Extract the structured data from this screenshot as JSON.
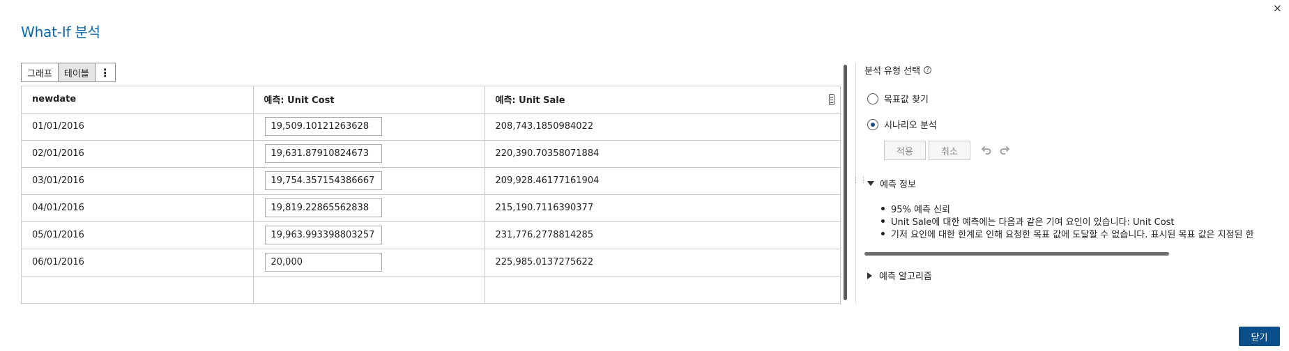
{
  "dialog": {
    "title": "What-If 분석",
    "close_icon": "×"
  },
  "toolbar": {
    "graph_label": "그래프",
    "table_label": "테이블",
    "more_icon": "⋮"
  },
  "table": {
    "columns": [
      "newdate",
      "예측: Unit Cost",
      "예측: Unit Sale"
    ],
    "rows": [
      {
        "date": "01/01/2016",
        "unit_cost": "19,509.10121263628",
        "unit_sale": "208,743.1850984022"
      },
      {
        "date": "02/01/2016",
        "unit_cost": "19,631.87910824673",
        "unit_sale": "220,390.70358071884"
      },
      {
        "date": "03/01/2016",
        "unit_cost": "19,754.357154386667",
        "unit_sale": "209,928.46177161904"
      },
      {
        "date": "04/01/2016",
        "unit_cost": "19,819.22865562838",
        "unit_sale": "215,190.7116390377"
      },
      {
        "date": "05/01/2016",
        "unit_cost": "19,963.993398803257",
        "unit_sale": "231,776.2778814285"
      },
      {
        "date": "06/01/2016",
        "unit_cost": "20,000",
        "unit_sale": "225,985.0137275622"
      }
    ]
  },
  "panel": {
    "heading": "분석 유형 선택",
    "help_icon": "?",
    "options": {
      "goal_seek": "목표값 찾기",
      "scenario": "시나리오 분석"
    },
    "selected_option": "scenario",
    "apply_label": "적용",
    "cancel_label": "취소",
    "forecast_info": {
      "title": "예측 정보",
      "items": [
        "95% 예측 신뢰",
        "Unit Sale에 대한 예측에는 다음과 같은 기여 요인이 있습니다: Unit Cost",
        "기저 요인에 대한 한계로 인해 요청한 목표 값에 도달할 수 없습니다. 표시된 목표 값은 지정된 한"
      ]
    },
    "algorithm_title": "예측 알고리즘"
  },
  "footer": {
    "close_label": "닫기"
  },
  "colors": {
    "accent": "#0b67a8",
    "primary_button": "#0b4f8a"
  }
}
